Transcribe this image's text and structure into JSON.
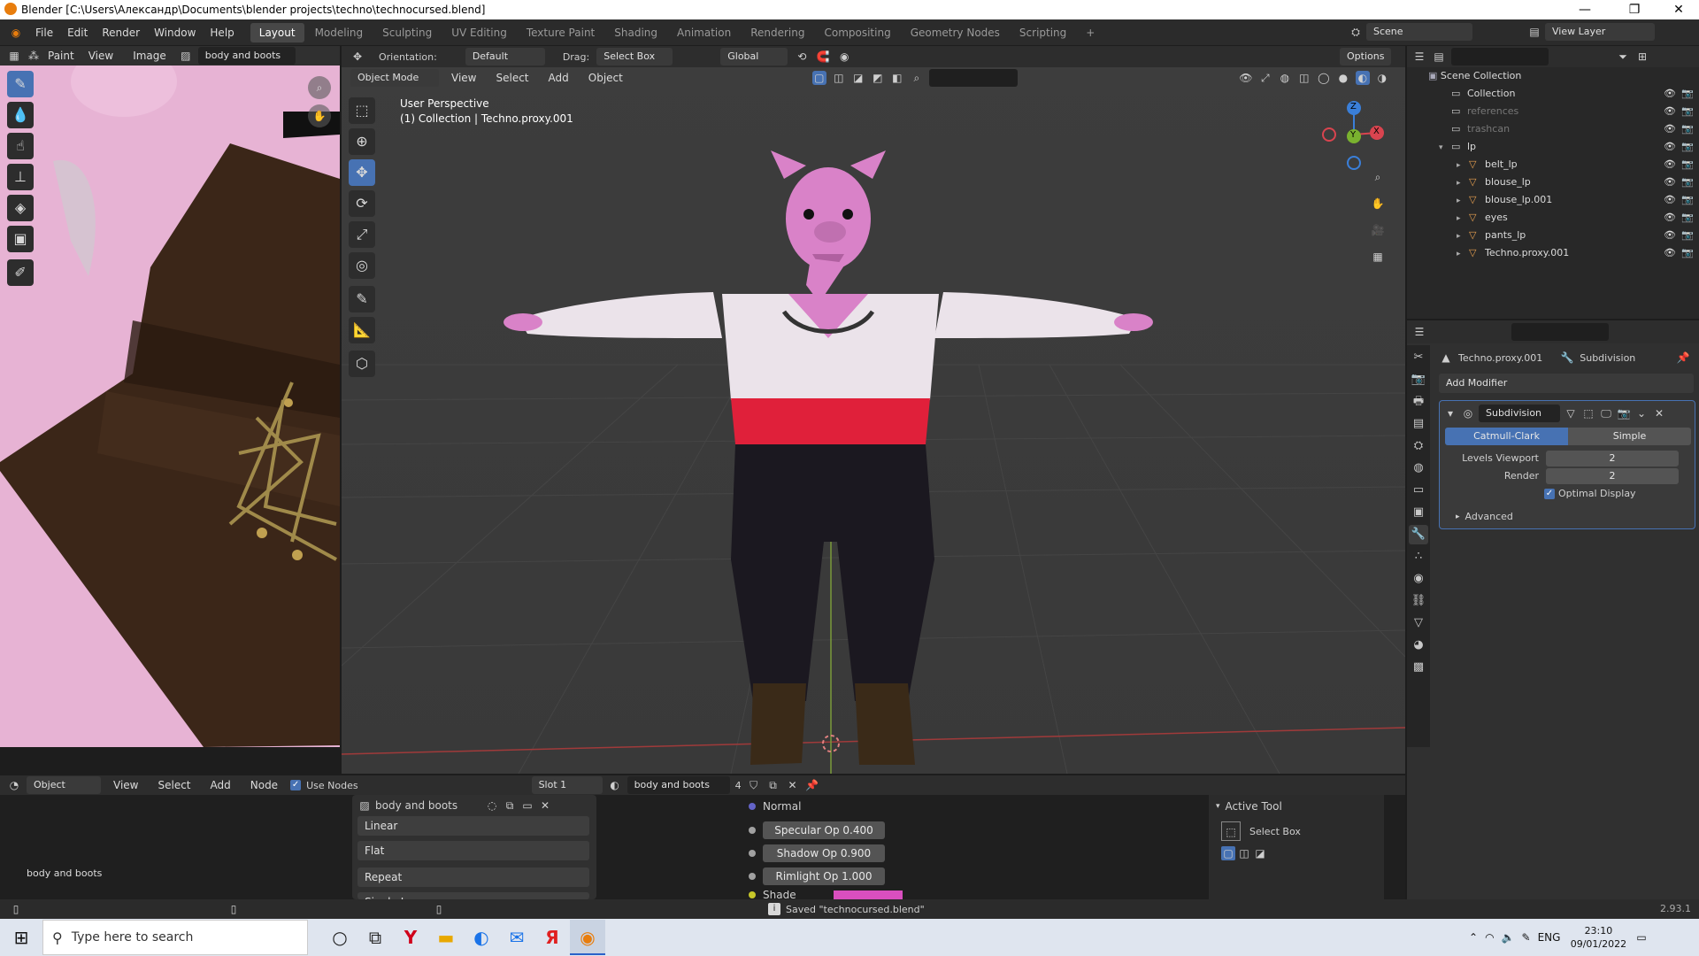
{
  "window": {
    "title": "Blender [C:\\Users\\Александр\\Documents\\blender projects\\techno\\technocursed.blend]",
    "minimize": "—",
    "maximize": "❐",
    "close": "✕"
  },
  "menu": [
    "File",
    "Edit",
    "Render",
    "Window",
    "Help"
  ],
  "workspaces": [
    "Layout",
    "Modeling",
    "Sculpting",
    "UV Editing",
    "Texture Paint",
    "Shading",
    "Animation",
    "Rendering",
    "Compositing",
    "Geometry Nodes",
    "Scripting"
  ],
  "active_workspace": "Layout",
  "scene": {
    "name": "Scene",
    "view_layer": "View Layer"
  },
  "image_editor": {
    "mode": "Paint",
    "view": "View",
    "image": "Image",
    "image_name": "body and boots"
  },
  "viewport_header": {
    "orientation_label": "Orientation:",
    "orientation_value": "Default",
    "drag_label": "Drag:",
    "drag_value": "Select Box",
    "transform_orientation": "Global",
    "options": "Options"
  },
  "viewport": {
    "mode": "Object Mode",
    "view": "View",
    "select": "Select",
    "add": "Add",
    "object": "Object",
    "perspective": "User Perspective",
    "collection_info": "(1) Collection | Techno.proxy.001",
    "gizmo": {
      "z": "Z",
      "y": "Y",
      "x": "X"
    }
  },
  "outliner": {
    "root": "Scene Collection",
    "items": [
      {
        "name": "Collection",
        "level": 1,
        "dim": false
      },
      {
        "name": "references",
        "level": 1,
        "dim": true
      },
      {
        "name": "trashcan",
        "level": 1,
        "dim": true
      },
      {
        "name": "lp",
        "level": 1,
        "dim": false
      },
      {
        "name": "belt_lp",
        "level": 2,
        "dim": false
      },
      {
        "name": "blouse_lp",
        "level": 2,
        "dim": false
      },
      {
        "name": "blouse_lp.001",
        "level": 2,
        "dim": false
      },
      {
        "name": "eyes",
        "level": 2,
        "dim": false
      },
      {
        "name": "pants_lp",
        "level": 2,
        "dim": false
      },
      {
        "name": "Techno.proxy.001",
        "level": 2,
        "dim": false
      }
    ]
  },
  "properties": {
    "object": "Techno.proxy.001",
    "modifier_tab": "Subdivision",
    "add_modifier": "Add Modifier",
    "modifier_name": "Subdivision",
    "catmull": "Catmull-Clark",
    "simple": "Simple",
    "levels_viewport_label": "Levels Viewport",
    "levels_viewport": "2",
    "render_label": "Render",
    "render_value": "2",
    "optimal_display": "Optimal Display",
    "advanced": "Advanced"
  },
  "shader_editor": {
    "type": "Object",
    "view": "View",
    "select": "Select",
    "add": "Add",
    "node": "Node",
    "use_nodes": "Use Nodes",
    "slot": "Slot 1",
    "material": "body and boots",
    "users": "4",
    "frame_label": "body and boots",
    "image_node_name": "body and boots",
    "interp": "Linear",
    "projection": "Flat",
    "extension": "Repeat",
    "source": "Single Image",
    "normal": "Normal",
    "specular": "Specular Op  0.400",
    "shadow": "Shadow Op  0.900",
    "rimlight": "Rimlight Op  1.000",
    "shade": "Shade"
  },
  "active_tool": {
    "title": "Active Tool",
    "tool": "Select Box"
  },
  "status": {
    "saved": "Saved \"technocursed.blend\"",
    "version": "2.93.1"
  },
  "taskbar": {
    "search_placeholder": "Type here to search",
    "lang": "ENG",
    "time": "23:10",
    "date": "09/01/2022"
  },
  "colors": {
    "accent": "#4772b3",
    "sash": "#e0203a",
    "pig_skin": "#d982c8",
    "paint_bg": "#e7b3d4"
  }
}
